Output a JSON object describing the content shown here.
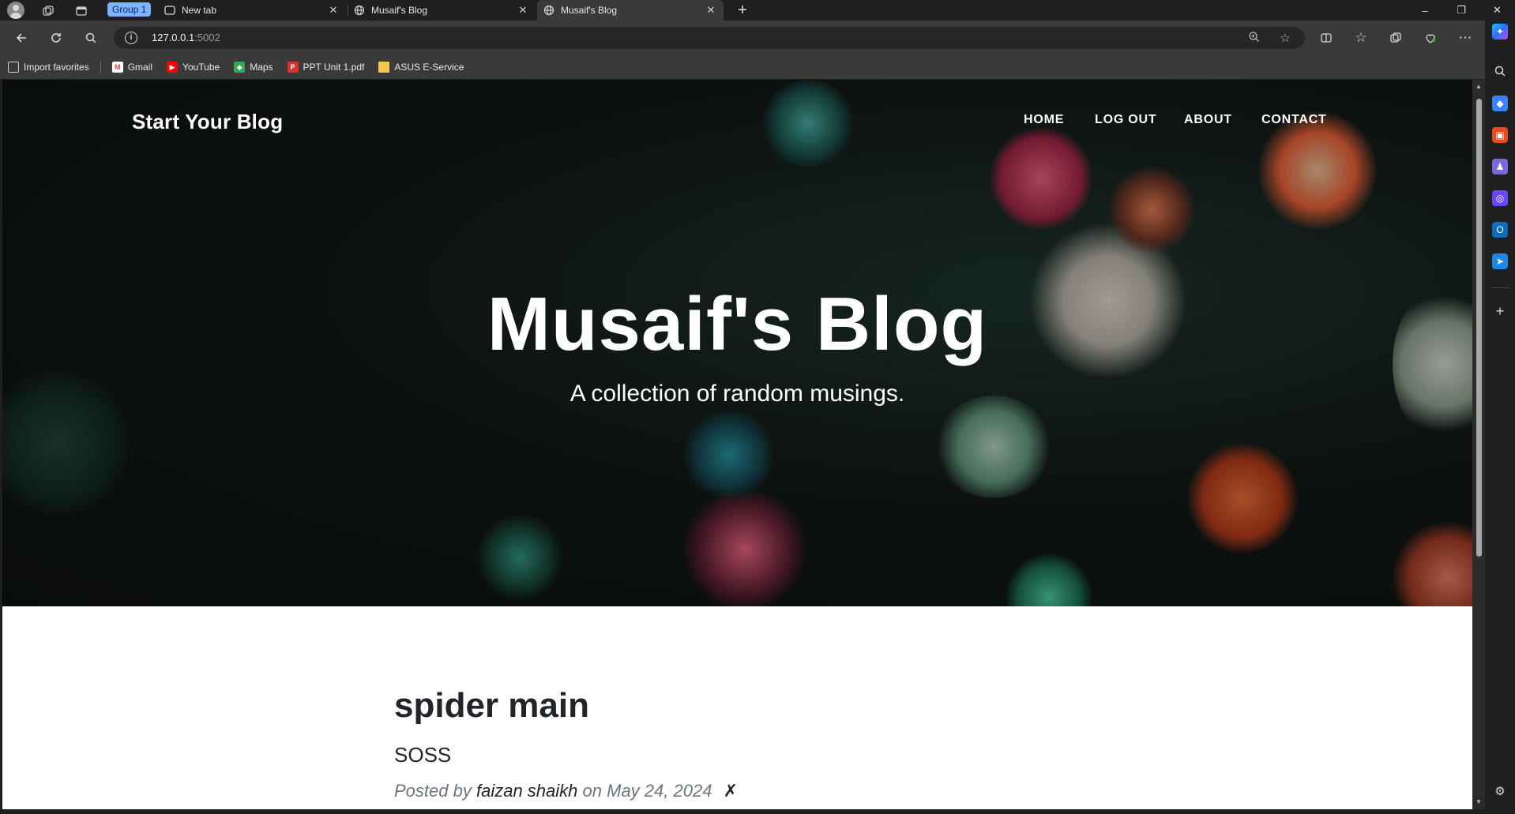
{
  "browser": {
    "group_label": "Group 1",
    "tabs": [
      {
        "label": "New tab"
      },
      {
        "label": "Musaif's Blog"
      },
      {
        "label": "Musaif's Blog"
      }
    ],
    "new_tab_symbol": "+",
    "window_controls": {
      "minimize": "–",
      "restore": "❐",
      "close": "✕"
    }
  },
  "toolbar": {
    "url_host": "127.0.0.1",
    "url_port": ":5002"
  },
  "favorites": [
    {
      "label": "Import favorites",
      "icon": "import-icon",
      "color": "#cfcfcf"
    },
    {
      "label": "Gmail",
      "icon": "gmail-icon",
      "color": "#ea4335"
    },
    {
      "label": "YouTube",
      "icon": "youtube-icon",
      "color": "#ff0000"
    },
    {
      "label": "Maps",
      "icon": "maps-icon",
      "color": "#34a853"
    },
    {
      "label": "PPT Unit 1.pdf",
      "icon": "pdf-icon",
      "color": "#d9322b"
    },
    {
      "label": "ASUS E-Service",
      "icon": "folder-icon",
      "color": "#f2c94c"
    }
  ],
  "page": {
    "brand": "Start Your Blog",
    "nav": [
      "HOME",
      "LOG OUT",
      "ABOUT",
      "CONTACT"
    ],
    "hero_title": "Musaif's Blog",
    "hero_subtitle": "A collection of random musings.",
    "post": {
      "title": "spider main",
      "subtitle": "SOSS",
      "meta_prefix": "Posted by",
      "author": "faizan shaikh",
      "meta_on": "on",
      "date": "May 24, 2024",
      "delete_symbol": "✗"
    }
  }
}
